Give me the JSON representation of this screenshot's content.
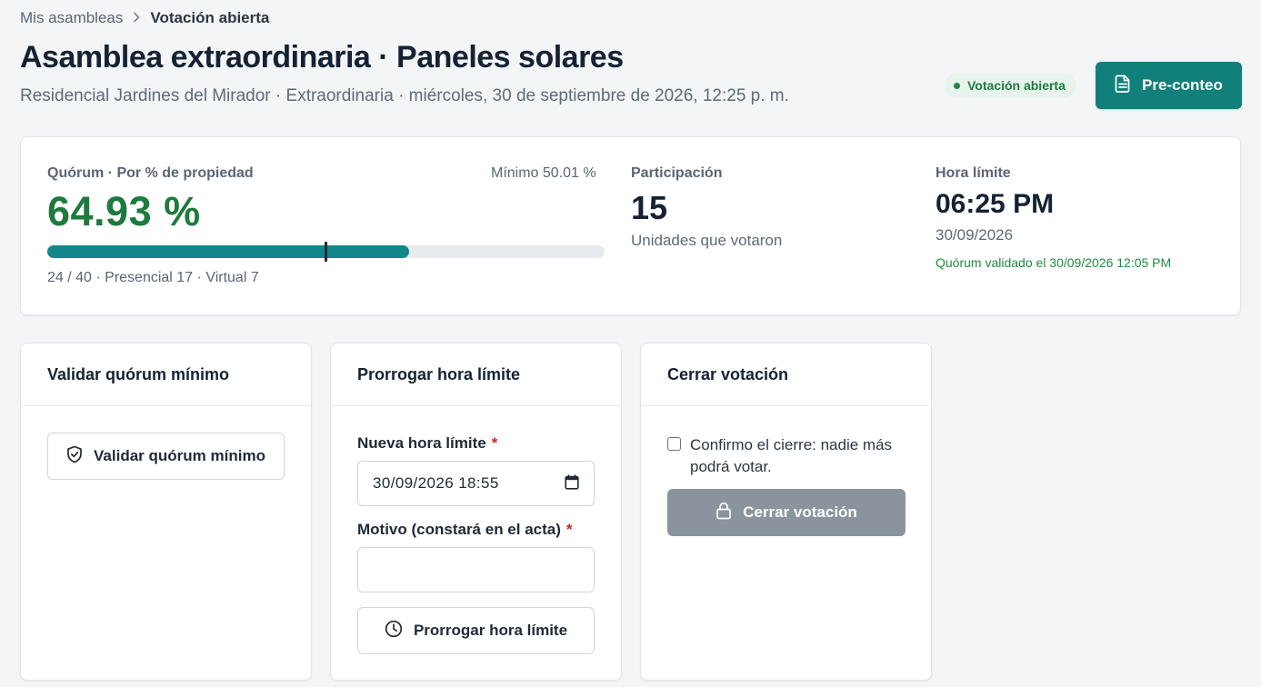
{
  "breadcrumb": {
    "parent": "Mis asambleas",
    "separator": ">",
    "current": "Votación abierta"
  },
  "header": {
    "title": "Asamblea extraordinaria · Paneles solares",
    "subtitle": "Residencial Jardines del Mirador · Extraordinaria · miércoles, 30 de septiembre de 2026, 12:25 p. m.",
    "status_badge": "Votación abierta",
    "preconteo_label": "Pre-conteo"
  },
  "summary": {
    "quorum": {
      "label": "Quórum · Por % de propiedad",
      "minimum_text": "Mínimo 50.01 %",
      "value_text": "64.93 %",
      "progress_fraction": 0.6493,
      "minimum_fraction": 0.5001,
      "detail": "24 / 40 · Presencial 17 · Virtual 7"
    },
    "participation": {
      "label": "Participación",
      "value": "15",
      "description": "Unidades que votaron"
    },
    "deadline": {
      "label": "Hora límite",
      "time": "06:25 PM",
      "date": "30/09/2026",
      "note": "Quórum validado el 30/09/2026 12:05 PM"
    }
  },
  "panels": {
    "validate": {
      "title": "Validar quórum mínimo",
      "button_label": "Validar quórum mínimo"
    },
    "extend": {
      "title": "Prorrogar hora límite",
      "new_deadline_label": "Nueva hora límite",
      "new_deadline_value": "30/09/2026 18:55",
      "reason_label": "Motivo (constará en el acta)",
      "reason_value": "",
      "required_mark": "*",
      "button_label": "Prorrogar hora límite"
    },
    "close": {
      "title": "Cerrar votación",
      "confirm_text": "Confirmo el cierre: nadie más podrá votar.",
      "confirm_checked": false,
      "button_label": "Cerrar votación"
    }
  },
  "icons": {
    "chevron": "chevron-right-icon",
    "document": "document-icon",
    "shield": "shield-check-icon",
    "calendar": "calendar-icon",
    "clock": "clock-icon",
    "lock": "lock-icon"
  },
  "colors": {
    "primary": "#12807a",
    "quorum_green": "#1e7a3e",
    "badge_bg": "#e7f3ec",
    "disabled_button": "#8b949e",
    "required": "#c62828"
  }
}
